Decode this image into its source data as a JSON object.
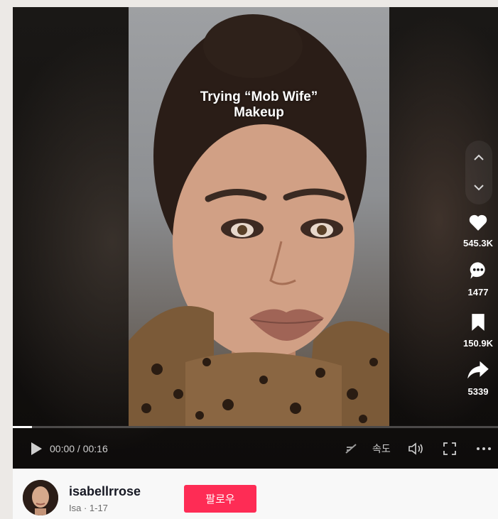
{
  "video": {
    "caption_line1": "Trying “Mob Wife”",
    "caption_line2": "Makeup"
  },
  "navigation": {
    "prev_icon": "chevron-up-icon",
    "next_icon": "chevron-down-icon"
  },
  "actions": {
    "likes": "545.3K",
    "comments": "1477",
    "bookmarks": "150.9K",
    "shares": "5339"
  },
  "player": {
    "time": "00:00 / 00:16",
    "speed_label": "속도",
    "progress_fraction": 0.04
  },
  "author": {
    "username": "isabellrrose",
    "subline": "Isa · 1-17",
    "follow_label": "팔로우"
  },
  "colors": {
    "follow_button": "#fe2c55",
    "background": "#ece9e6"
  }
}
